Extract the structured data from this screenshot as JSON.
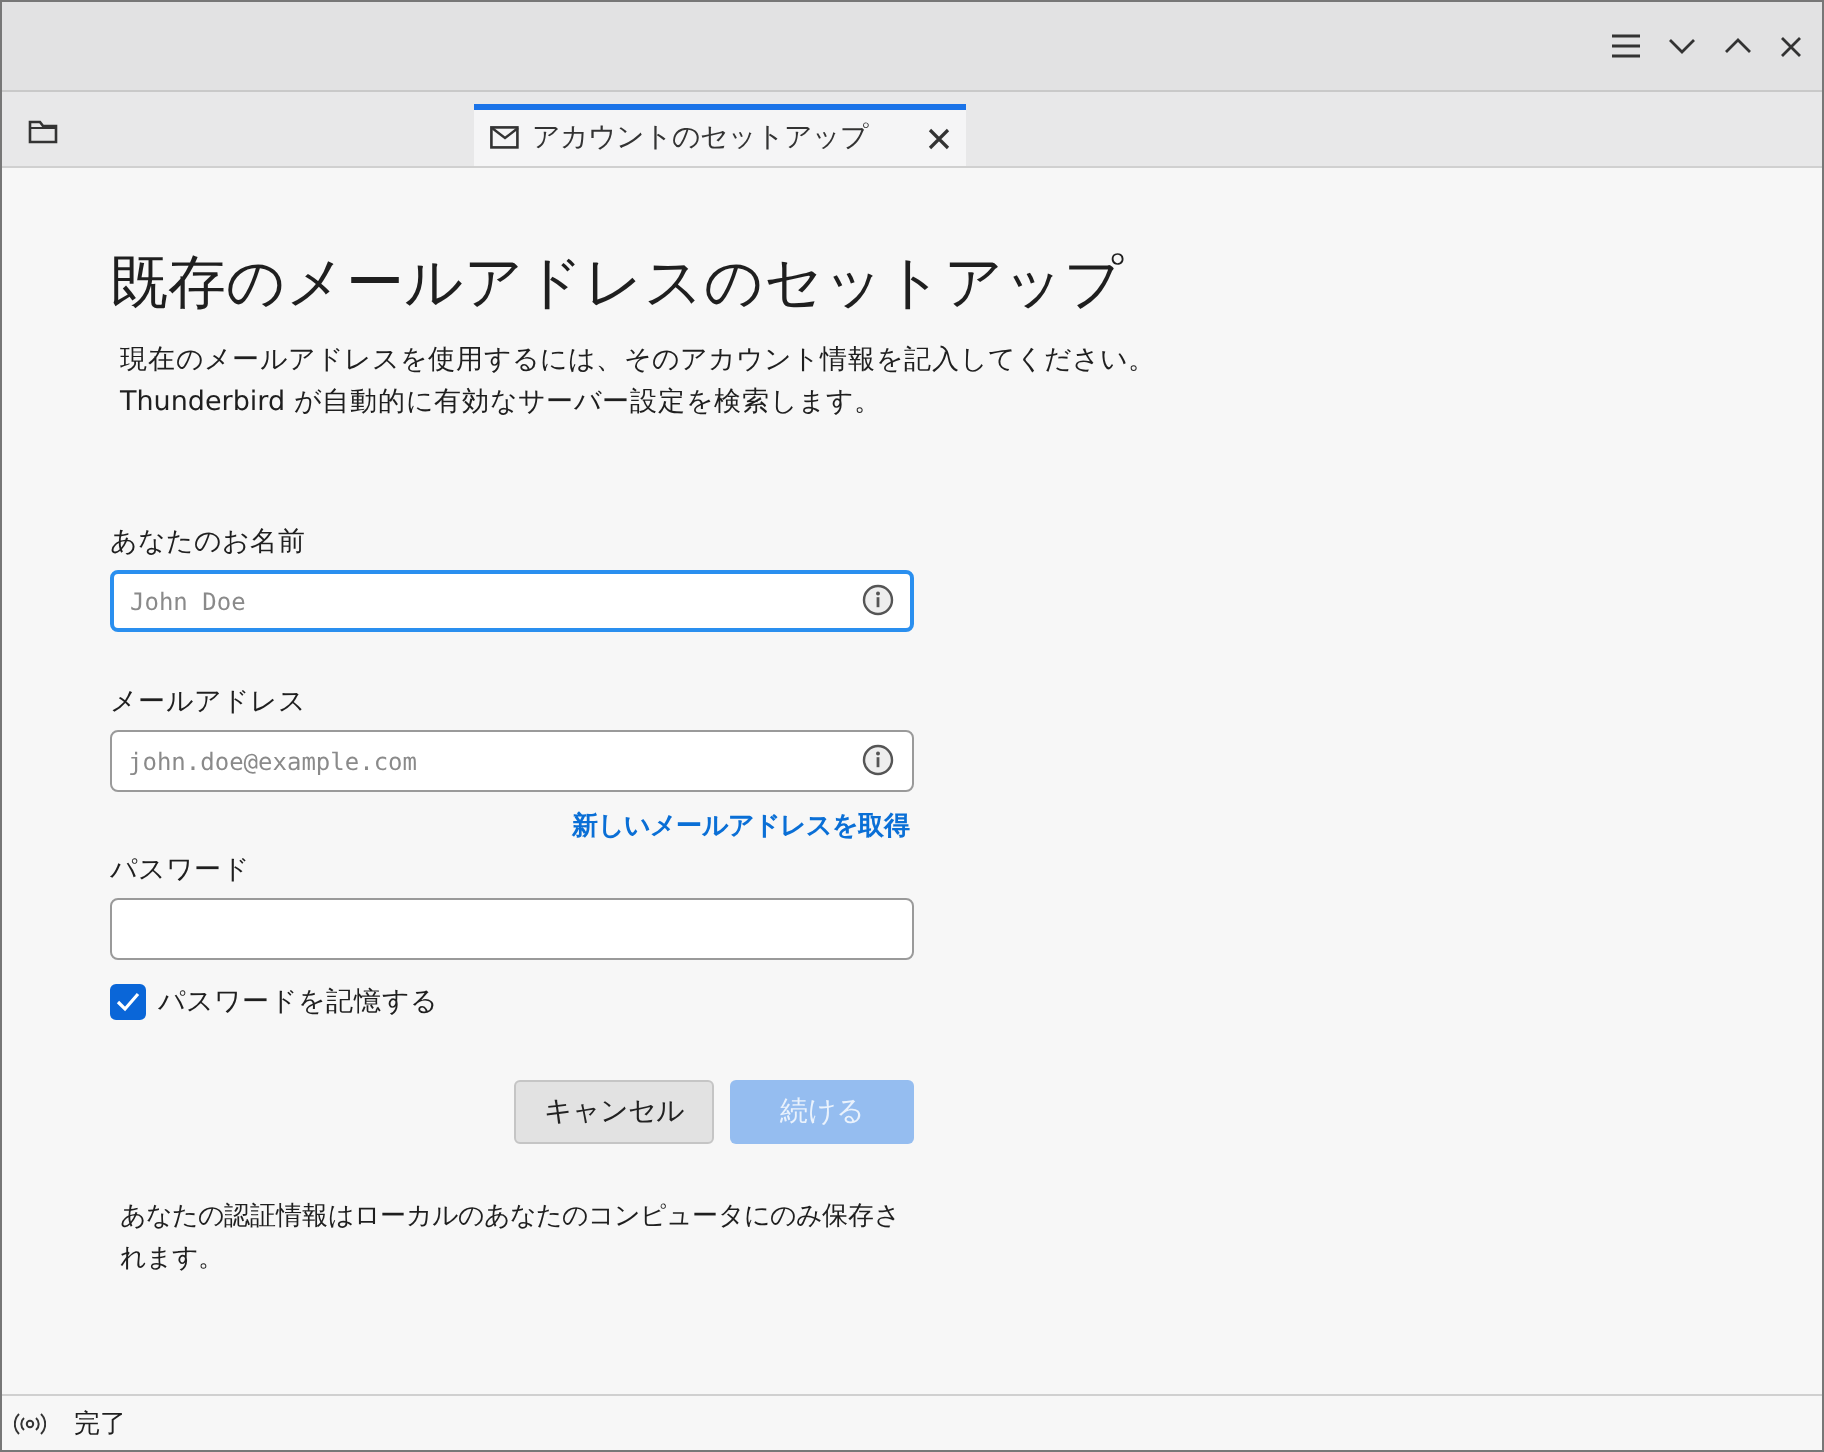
{
  "tabs": [
    {
      "label": "アカウントのセットアップ",
      "selected": true
    }
  ],
  "heading": "既存のメールアドレスのセットアップ",
  "description": [
    "現在のメールアドレスを使用するには、そのアカウント情報を記入してください。",
    "Thunderbird が自動的に有効なサーバー設定を検索します。"
  ],
  "fields": [
    {
      "label": "あなたのお名前",
      "placeholder": "John Doe",
      "focused": true,
      "info": true
    },
    {
      "label": "メールアドレス",
      "placeholder": "john.doe@example.com",
      "focused": false,
      "info": true,
      "link": "新しいメールアドレスを取得"
    },
    {
      "label": "パスワード",
      "focused": false,
      "info": false
    }
  ],
  "remember": {
    "label": "パスワードを記憶する",
    "checked": true
  },
  "buttons": [
    {
      "label": "キャンセル",
      "disabled": false
    },
    {
      "label": "続ける",
      "disabled": true
    }
  ],
  "note": "あなたの認証情報はローカルのあなたのコンピュータにのみ保存されます。",
  "status_bar": {
    "text": "完了"
  }
}
